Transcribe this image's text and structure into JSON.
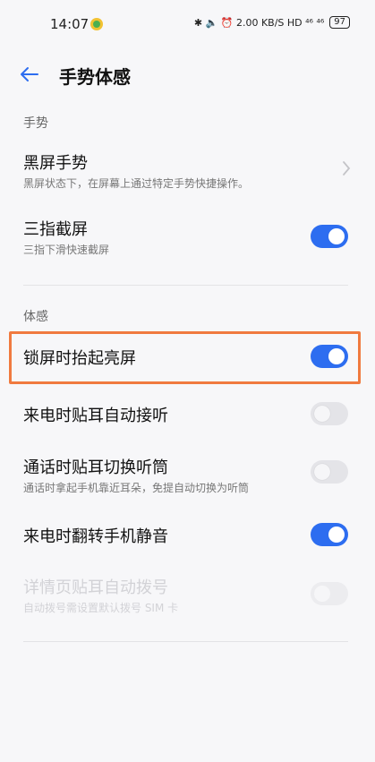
{
  "status_bar": {
    "time": "14:07",
    "right_text": "✱ 🔈 ⏰ 2.00 KB/S HD ⁴⁶ ⁴⁶",
    "battery": "97"
  },
  "header": {
    "title": "手势体感"
  },
  "sections": {
    "gesture": {
      "label": "手势",
      "items": [
        {
          "title": "黑屏手势",
          "subtitle": "黑屏状态下，在屏幕上通过特定手势快捷操作。"
        },
        {
          "title": "三指截屏",
          "subtitle": "三指下滑快速截屏",
          "toggle": "on"
        }
      ]
    },
    "motion": {
      "label": "体感",
      "items": [
        {
          "title": "锁屏时抬起亮屏",
          "toggle": "on"
        },
        {
          "title": "来电时贴耳自动接听",
          "toggle": "off"
        },
        {
          "title": "通话时贴耳切换听筒",
          "subtitle": "通话时拿起手机靠近耳朵，免提自动切换为听筒",
          "toggle": "off"
        },
        {
          "title": "来电时翻转手机静音",
          "toggle": "on"
        },
        {
          "title": "详情页贴耳自动拨号",
          "subtitle": "自动拨号需设置默认拨号 SIM 卡",
          "toggle": "disabled"
        }
      ]
    }
  },
  "colors": {
    "accent": "#2d6df0",
    "highlight": "#f07a3f"
  }
}
